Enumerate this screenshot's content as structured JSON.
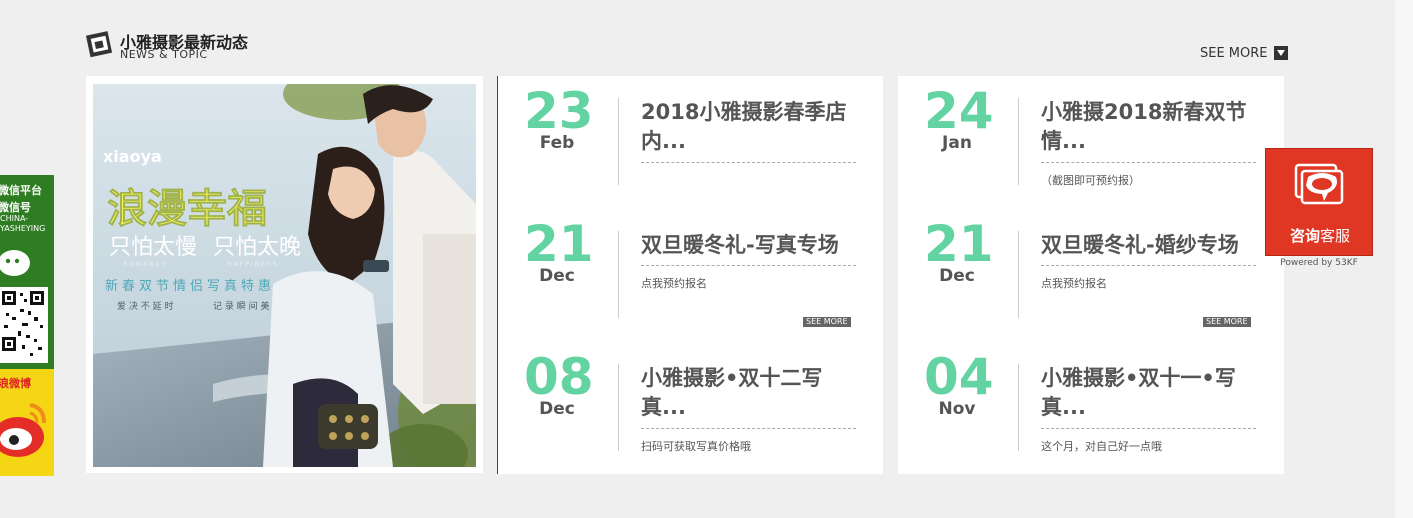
{
  "section": {
    "title": "小雅摄影最新动态",
    "subtitle": "NEWS & TOPIC",
    "see_more": "SEE MORE"
  },
  "feature": {
    "logo": "xiaoya",
    "headline": "浪漫幸福",
    "tag_left": "只怕太慢",
    "tag_right": "只怕太晚",
    "tag_left_en": "ROMANCE",
    "tag_right_en": "HAPPINESS",
    "promo": "新春双节情侣写真特惠",
    "slogan_left": "爱 决 不 延 时",
    "slogan_right": "记 录 瞬 间 美"
  },
  "news": {
    "left": [
      {
        "day": "23",
        "month": "Feb",
        "title": "2018小雅摄影春季店内...",
        "desc": "",
        "more": ""
      },
      {
        "day": "21",
        "month": "Dec",
        "title": "双旦暖冬礼-写真专场",
        "desc": "点我预约报名",
        "more": "SEE MORE"
      },
      {
        "day": "08",
        "month": "Dec",
        "title": "小雅摄影•双十二写真...",
        "desc": "扫码可获取写真价格哦",
        "more": ""
      }
    ],
    "right": [
      {
        "day": "24",
        "month": "Jan",
        "title": "小雅摄2018新春双节情...",
        "desc": "（截图即可预约报）",
        "more": ""
      },
      {
        "day": "21",
        "month": "Dec",
        "title": "双旦暖冬礼-婚纱专场",
        "desc": "点我预约报名",
        "more": "SEE MORE"
      },
      {
        "day": "04",
        "month": "Nov",
        "title": "小雅摄影•双十一•写真...",
        "desc": "这个月，对自己好一点哦",
        "more": ""
      }
    ]
  },
  "social": {
    "wechat_label_1": "微信平台",
    "wechat_label_2": "微信号",
    "wechat_id": "CHINA-YASHEYING",
    "weibo_label": "浪微博"
  },
  "consult": {
    "label_bold": "咨询",
    "label_rest": "客服",
    "powered": "Powered by 53KF"
  },
  "colors": {
    "accent_green": "#62d3a1",
    "consult_red": "#e03624",
    "wechat_green": "#2f7d22",
    "weibo_yellow": "#f5d615"
  }
}
